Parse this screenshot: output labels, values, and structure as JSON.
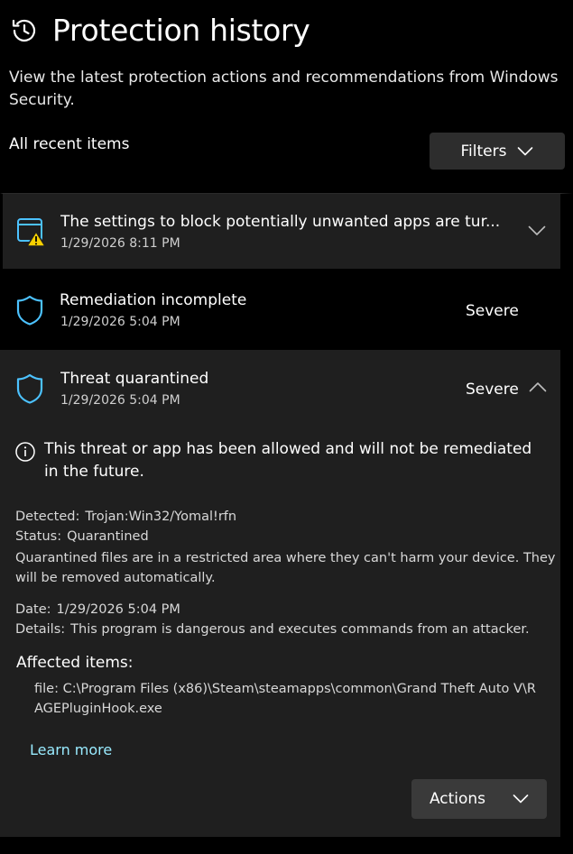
{
  "header": {
    "title": "Protection history",
    "icon": "history-icon",
    "description": "View the latest protection actions and recommendations from Windows Security."
  },
  "section_label": "All recent items",
  "filters": {
    "label": "Filters",
    "icon": "chevron-down-icon"
  },
  "items": [
    {
      "title": "The settings to block potentially unwanted apps are tur...",
      "date": "1/29/2026 8:11 PM",
      "icon": "app-browser-warning-icon",
      "expand_icon": "chevron-down-icon"
    },
    {
      "title": "Remediation incomplete",
      "date": "1/29/2026 5:04 PM",
      "severity": "Severe",
      "icon": "shield-icon"
    },
    {
      "title": "Threat quarantined",
      "date": "1/29/2026 5:04 PM",
      "severity": "Severe",
      "icon": "shield-icon",
      "expand_icon": "chevron-up-icon",
      "info_message": "This threat or app has been allowed and will not be remediated in the future.",
      "detected_label": "Detected:",
      "detected_value": "Trojan:Win32/Yomal!rfn",
      "status_label": "Status:",
      "status_value": "Quarantined",
      "status_note": "Quarantined files are in a restricted area where they can't harm your device. They will be removed automatically.",
      "date_label": "Date:",
      "date_value": "1/29/2026 5:04 PM",
      "details_label": "Details:",
      "details_value": "This program is dangerous and executes commands from an attacker.",
      "affected_label": "Affected items:",
      "affected_file": "file: C:\\Program Files (x86)\\Steam\\steamapps\\common\\Grand Theft Auto V\\RAGEPluginHook.exe",
      "learn_more": "Learn more",
      "actions_label": "Actions"
    }
  ],
  "colors": {
    "background": "#000000",
    "card": "#1f1f1f",
    "button": "#2d2d2d",
    "accent_blue": "#4cc2ff",
    "warning_yellow": "#f7d000",
    "link": "#99ebff"
  }
}
